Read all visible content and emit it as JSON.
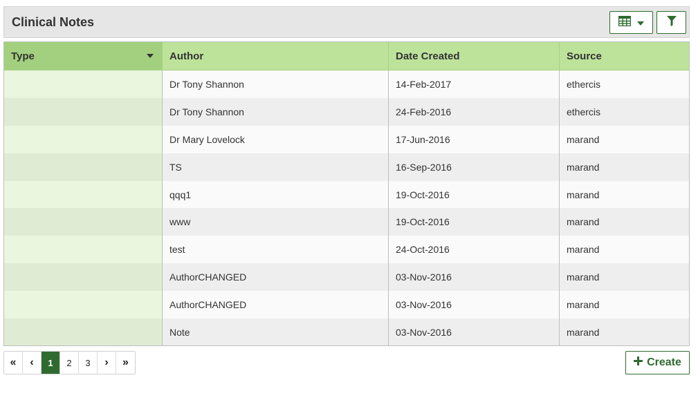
{
  "panel": {
    "title": "Clinical Notes"
  },
  "toolbar": {
    "table_icon": "table-icon",
    "filter_icon": "filter-icon"
  },
  "table": {
    "headers": {
      "type": "Type",
      "author": "Author",
      "date_created": "Date Created",
      "source": "Source"
    },
    "rows": [
      {
        "type": "",
        "author": "Dr Tony Shannon",
        "date_created": "14-Feb-2017",
        "source": "ethercis"
      },
      {
        "type": "",
        "author": "Dr Tony Shannon",
        "date_created": "24-Feb-2016",
        "source": "ethercis"
      },
      {
        "type": "",
        "author": "Dr Mary Lovelock",
        "date_created": "17-Jun-2016",
        "source": "marand"
      },
      {
        "type": "",
        "author": "TS",
        "date_created": "16-Sep-2016",
        "source": "marand"
      },
      {
        "type": "",
        "author": "qqq1",
        "date_created": "19-Oct-2016",
        "source": "marand"
      },
      {
        "type": "",
        "author": "www",
        "date_created": "19-Oct-2016",
        "source": "marand"
      },
      {
        "type": "",
        "author": "test",
        "date_created": "24-Oct-2016",
        "source": "marand"
      },
      {
        "type": "",
        "author": "AuthorCHANGED",
        "date_created": "03-Nov-2016",
        "source": "marand"
      },
      {
        "type": "",
        "author": "AuthorCHANGED",
        "date_created": "03-Nov-2016",
        "source": "marand"
      },
      {
        "type": "",
        "author": "Note",
        "date_created": "03-Nov-2016",
        "source": "marand"
      }
    ]
  },
  "pagination": {
    "first": "«",
    "prev": "‹",
    "next": "›",
    "last": "»",
    "pages": [
      "1",
      "2",
      "3"
    ],
    "current": "1"
  },
  "create_button": {
    "label": "Create",
    "icon": "plus-icon"
  },
  "colors": {
    "accent": "#2e6b2f",
    "header_bg": "#bde39b",
    "sorted_header_bg": "#a3d07e"
  }
}
